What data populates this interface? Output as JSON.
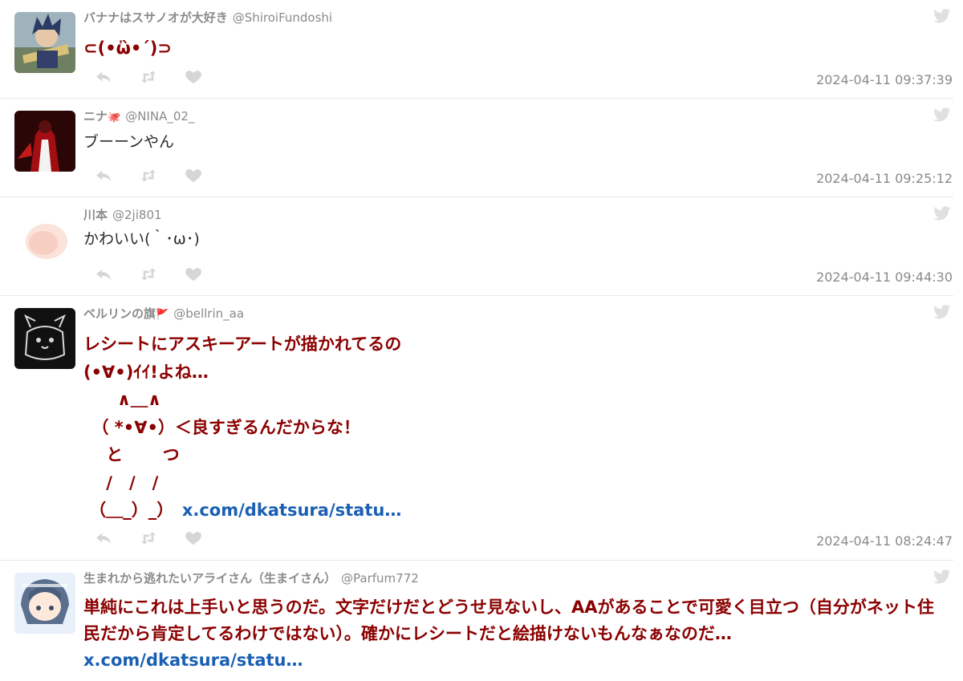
{
  "tweets": [
    {
      "name": "バナナはスサノオが大好き",
      "handle": "@ShiroiFundoshi",
      "text": "⊂(•ὢ•´)⊃",
      "time": "2024-04-11 09:37:39"
    },
    {
      "name": "ニナ",
      "badge": "🐙",
      "handle": "@NINA_02_",
      "text": "ブーーンやん",
      "time": "2024-04-11 09:25:12"
    },
    {
      "name": "川本",
      "handle": "@2ji801",
      "text": "かわいい(｀･ω･)",
      "time": "2024-04-11 09:44:30"
    },
    {
      "name": "ベルリンの旗",
      "badge": "🚩",
      "handle": "@bellrin_aa",
      "text": "レシートにアスキーアートが描かれてるの\n(•∀•)ｲｲ!よね…\n　　∧＿∧\n　（ *•∀•）＜良すぎるんだからな！\n　 と　　 つ\n　 /　/　/\n （＿_）_）",
      "link": "x.com/dkatsura/statu…",
      "time": "2024-04-11 08:24:47"
    },
    {
      "name": "生まれから逃れたいアライさん（生まイさん）",
      "handle": "@Parfum772",
      "text": "単純にこれは上手いと思うのだ。文字だけだとどうせ見ないし、AAがあることで可愛く目立つ（自分がネット住民だから肯定してるわけではない）。確かにレシートだと絵描けないもんなぁなのだ…",
      "link": "x.com/dkatsura/statu…"
    }
  ],
  "colors": {
    "highlight": "#8b0000",
    "link": "#1a5fb4",
    "meta": "#8a8a8a",
    "icon": "#d6d6d6"
  },
  "icons": [
    "reply-icon",
    "retweet-icon",
    "like-icon",
    "twitter-bird-icon"
  ]
}
